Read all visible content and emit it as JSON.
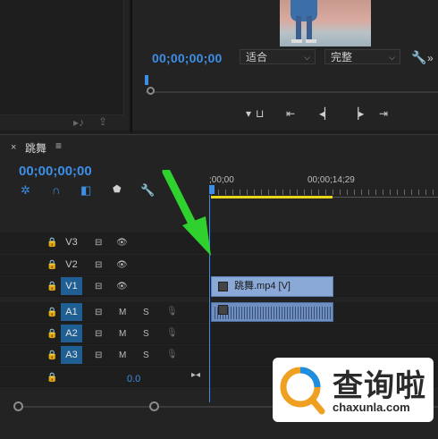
{
  "program_monitor": {
    "timecode": "00;00;00;00",
    "fit_dropdown": "适合",
    "quality_dropdown": "完整"
  },
  "timeline": {
    "tab_title": "跳舞",
    "timecode": "00;00;00;00",
    "ruler_labels": [
      ";00;00",
      "00;00;14;29"
    ],
    "video_tracks": [
      "V3",
      "V2",
      "V1"
    ],
    "audio_tracks": [
      "A1",
      "A2",
      "A3"
    ],
    "track_buttons": {
      "mute": "M",
      "solo": "S"
    },
    "master_value": "0.0",
    "video_clip_label": "跳舞.mp4 [V]"
  },
  "watermark": {
    "name": "查询啦",
    "url": "chaxunla.com"
  },
  "colors": {
    "accent_blue": "#3d8ee6",
    "workarea_yellow": "#e8d71b",
    "clip_video": "#8aa9d6",
    "clip_audio": "#6f8fc0",
    "arrow_green": "#2fd12f"
  }
}
